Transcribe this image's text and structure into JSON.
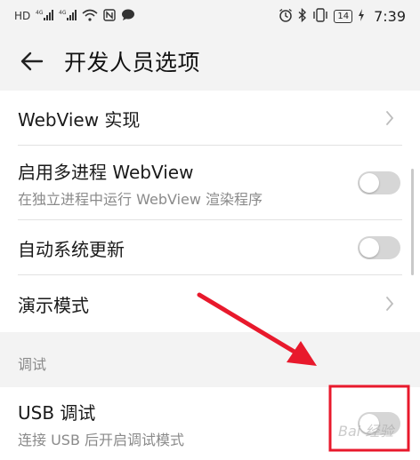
{
  "status_bar": {
    "left_icons": [
      "HD",
      "4G",
      "4G",
      "wifi",
      "N",
      "message"
    ],
    "right_icons": [
      "alarm",
      "bluetooth",
      "vibrate"
    ],
    "battery": "14",
    "time": "7:39"
  },
  "header": {
    "back_icon": "arrow-left",
    "title": "开发人员选项"
  },
  "settings": {
    "webview_impl": {
      "title": "WebView 实现"
    },
    "multiprocess_webview": {
      "title": "启用多进程 WebView",
      "subtitle": "在独立进程中运行 WebView 渲染程序",
      "enabled": false
    },
    "auto_update": {
      "title": "自动系统更新",
      "enabled": false
    },
    "demo_mode": {
      "title": "演示模式"
    }
  },
  "debug_section": {
    "header": "调试",
    "usb_debug": {
      "title": "USB 调试",
      "subtitle": "连接 USB 后开启调试模式",
      "enabled": false
    }
  },
  "annotation": {
    "arrow_color": "#e8192c",
    "box_color": "#e8192c"
  },
  "watermark": "Bai 经验"
}
